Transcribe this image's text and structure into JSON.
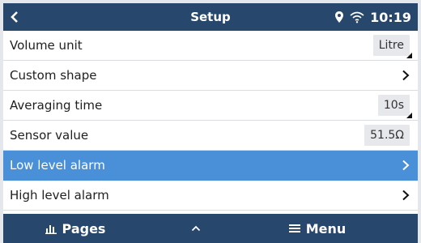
{
  "header": {
    "title": "Setup",
    "time": "10:19"
  },
  "rows": [
    {
      "label": "Volume unit",
      "value": "Litre"
    },
    {
      "label": "Custom shape"
    },
    {
      "label": "Averaging time",
      "value": "10s"
    },
    {
      "label": "Sensor value",
      "value": "51.5Ω"
    },
    {
      "label": "Low level alarm"
    },
    {
      "label": "High level alarm"
    }
  ],
  "footer": {
    "pages_label": "Pages",
    "menu_label": "Menu"
  },
  "colors": {
    "header": "#27476c",
    "selected": "#4a90d9"
  },
  "icons": [
    "back-chevron-icon",
    "location-pin-icon",
    "wifi-icon",
    "chevron-right-icon",
    "bar-chart-icon",
    "chevron-up-icon",
    "hamburger-menu-icon"
  ]
}
